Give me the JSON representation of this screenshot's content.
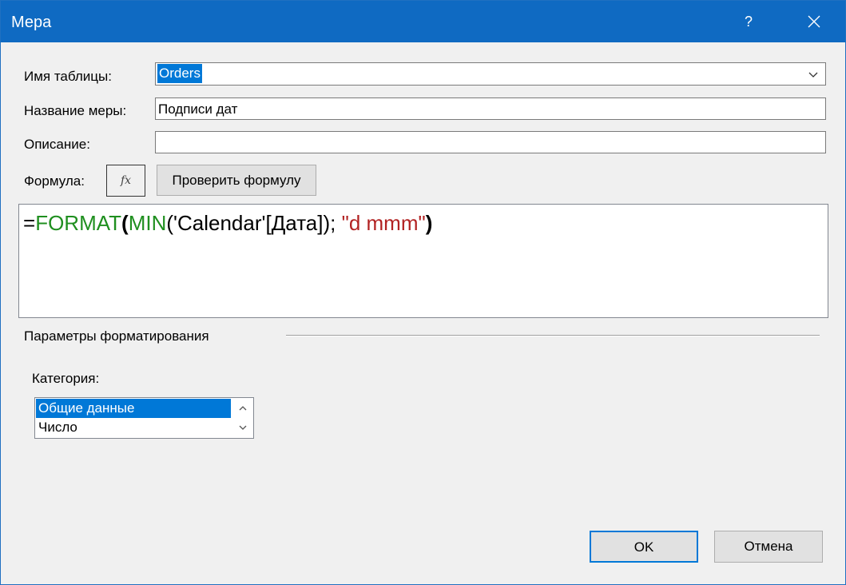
{
  "window": {
    "title": "Мера",
    "help_label": "?"
  },
  "form": {
    "table_name_label": "Имя таблицы:",
    "table_name_value": "Orders",
    "measure_name_label": "Название меры:",
    "measure_name_value": "Подписи дат",
    "description_label": "Описание:",
    "description_value": "",
    "formula_label": "Формула:",
    "fx_label": "fx",
    "check_formula_label": "Проверить формулу"
  },
  "formula": {
    "eq": "=",
    "fn1": "FORMAT",
    "open1": "(",
    "fn2": "MIN",
    "arg": "('Calendar'[Дата]); ",
    "str": "\"d mmm\"",
    "close1": ")"
  },
  "formatting": {
    "group_label": "Параметры форматирования",
    "category_label": "Категория:",
    "categories": [
      "Общие данные",
      "Число"
    ],
    "selected_index": 0
  },
  "buttons": {
    "ok_label": "OK",
    "cancel_label": "Отмена"
  },
  "colors": {
    "titlebar": "#0f6ac2",
    "selection": "#0078d7",
    "function": "#1f8f1f",
    "string": "#b22222"
  }
}
